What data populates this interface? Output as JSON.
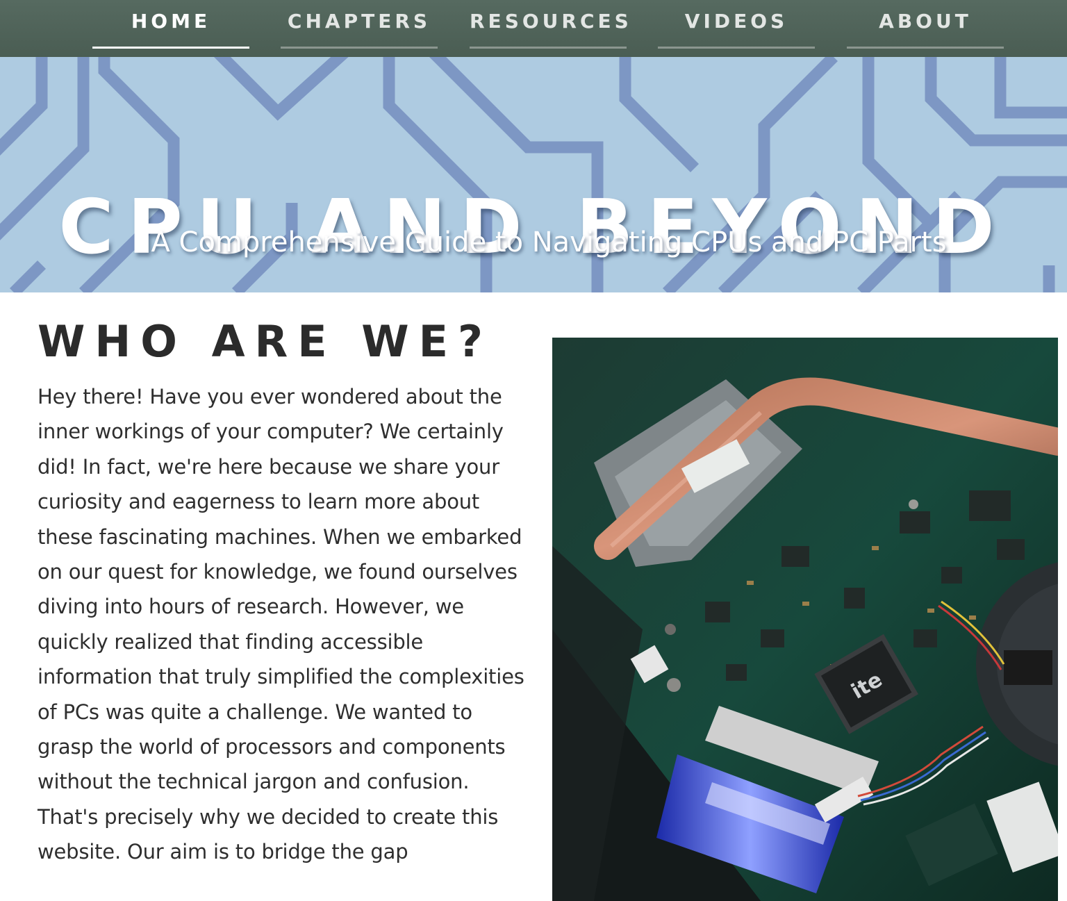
{
  "nav": {
    "items": [
      {
        "label": "HOME",
        "active": true
      },
      {
        "label": "CHAPTERS",
        "active": false
      },
      {
        "label": "RESOURCES",
        "active": false
      },
      {
        "label": "VIDEOS",
        "active": false
      },
      {
        "label": "ABOUT",
        "active": false
      }
    ]
  },
  "hero": {
    "title": "CPU AND BEYOND",
    "subtitle": "A Comprehensive Guide to Navigating CPUs and PC Parts"
  },
  "about": {
    "heading": "WHO ARE WE?",
    "body": "Hey there! Have you ever wondered about the inner workings of your computer? We certainly did! In fact, we're here because we share your curiosity and eagerness to learn more about these fascinating machines. When we embarked on our quest for knowledge, we found ourselves diving into hours of research. However, we quickly realized that finding accessible information that truly simplified the complexities of PCs was quite a challenge. We wanted to grasp the world of processors and components without the technical jargon and confusion. That's precisely why we decided to create this website. Our aim is to bridge the gap"
  },
  "photo": {
    "chip_label": "ite"
  },
  "colors": {
    "nav_bg": "#4f6258",
    "hero_bg": "#aecbe1",
    "trace": "#7d97c4",
    "heading": "#2b2b2b",
    "body_text": "#2e2e2e"
  }
}
